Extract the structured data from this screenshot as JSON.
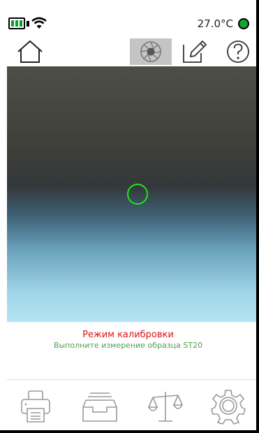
{
  "status": {
    "temperature": "27.0°C",
    "battery_icon": "battery-icon",
    "wifi_icon": "wifi-icon",
    "status_color": "#13a32f"
  },
  "toolbar": {
    "home_icon": "home-icon",
    "camera_icon": "camera-aperture-icon",
    "edit_icon": "edit-icon",
    "help_icon": "help-icon"
  },
  "message": {
    "title": "Режим калибровки",
    "subtitle": "Выполните измерение образца ST20",
    "title_color": "#d8151a",
    "subtitle_color": "#4fa04f"
  },
  "bottom_nav": {
    "print_icon": "printer-icon",
    "archive_icon": "archive-tray-icon",
    "scale_icon": "balance-scale-icon",
    "settings_icon": "gear-icon"
  }
}
